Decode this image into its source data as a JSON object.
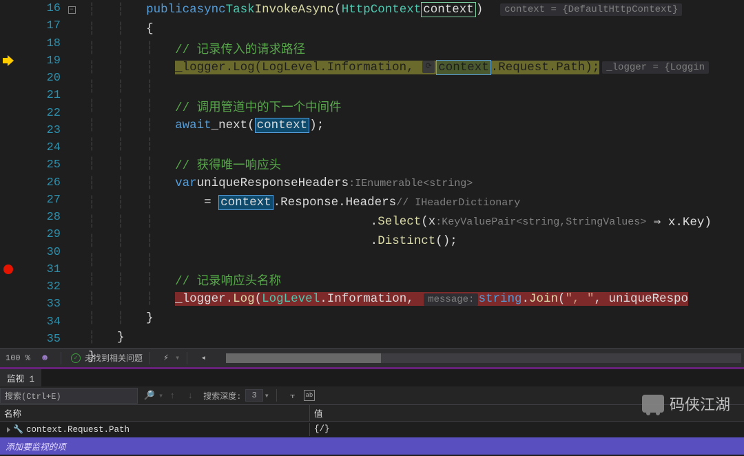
{
  "lines": {
    "16": {
      "indent": 2,
      "tokens": "public async Task InvokeAsync(HttpContext context)"
    },
    "17": {
      "indent": 2,
      "text": "{"
    },
    "18": {
      "indent": 3,
      "comment": "// 记录传入的请求路径"
    },
    "19": {
      "indent": 3,
      "code": "_logger.Log(LogLevel.Information, context.Request.Path);"
    },
    "20": {
      "indent": 3
    },
    "21": {
      "indent": 3,
      "comment": "// 调用管道中的下一个中间件"
    },
    "22": {
      "indent": 3,
      "code": "await _next(context);"
    },
    "23": {
      "indent": 3
    },
    "24": {
      "indent": 3,
      "comment": "// 获得唯一响应头"
    },
    "25": {
      "indent": 3,
      "code": "var uniqueResponseHeaders",
      "hint": ":IEnumerable<string>"
    },
    "26": {
      "indent": 4,
      "code": "= context.Response.Headers",
      "hint": "// IHeaderDictionary"
    },
    "27": {
      "indent": 0,
      "code": ".Select(x",
      "hint": ":KeyValuePair<string,StringValues>",
      "after": " ⇒ x.Key)"
    },
    "28": {
      "indent": 0,
      "code": ".Distinct();"
    },
    "29": {
      "indent": 3
    },
    "30": {
      "indent": 3,
      "comment": "// 记录响应头名称"
    },
    "31": {
      "indent": 3,
      "code": "_logger.Log(LogLevel.Information, ",
      "hint": "message:",
      "after": "string.Join(\", \", uniqueRespo"
    },
    "32": {
      "indent": 2,
      "text": "}"
    },
    "33": {
      "indent": 1,
      "text": "}"
    },
    "34": {
      "indent": 0,
      "text": "}"
    },
    "35": {}
  },
  "inlineValues": {
    "context": "context = {DefaultHttpContext}",
    "logger": "_logger = {Loggin"
  },
  "statusBar": {
    "zoom": "100 %",
    "issues": "未找到相关问题"
  },
  "watch": {
    "title": "监视 1",
    "searchPlaceholder": "搜索(Ctrl+E)",
    "depthLabel": "搜索深度:",
    "depthValue": "3",
    "colName": "名称",
    "colValue": "值",
    "row1Name": "context.Request.Path",
    "row1Value": "{/}",
    "addItem": "添加要监视的项"
  },
  "watermark": "码侠江湖"
}
